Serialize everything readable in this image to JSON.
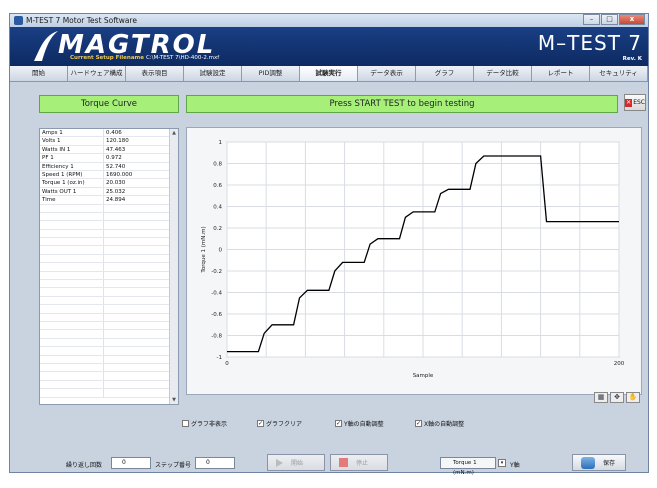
{
  "window": {
    "title": "M-TEST 7 Motor Test Software",
    "controls": [
      "–",
      "□",
      "x"
    ]
  },
  "banner": {
    "logo": "MAGTROL",
    "setup_label": "Current Setup Filename",
    "setup_file": "C:\\M-TEST 7\\HD-400-2.mxf",
    "product": "M–TEST 7",
    "rev": "Rev. K"
  },
  "tabs": [
    {
      "label": "開始"
    },
    {
      "label": "ハードウェア構成"
    },
    {
      "label": "表示項目"
    },
    {
      "label": "試験設定"
    },
    {
      "label": "PID調整"
    },
    {
      "label": "試験実行",
      "active": true
    },
    {
      "label": "データ表示"
    },
    {
      "label": "グラフ"
    },
    {
      "label": "データ比較"
    },
    {
      "label": "レポート"
    },
    {
      "label": "セキュリティ"
    }
  ],
  "curve_label": "Torque Curve",
  "status": "Press START TEST to begin testing",
  "esc_label": "ESC",
  "readings": [
    {
      "name": "Amps 1",
      "value": "0.406"
    },
    {
      "name": "Volts 1",
      "value": "120.180"
    },
    {
      "name": "Watts IN 1",
      "value": "47.463"
    },
    {
      "name": "PF 1",
      "value": "0.972"
    },
    {
      "name": "Efficiency 1",
      "value": "52.740"
    },
    {
      "name": "Speed 1 (RPM)",
      "value": "1690.000"
    },
    {
      "name": "Torque 1 (oz.in)",
      "value": "20.030"
    },
    {
      "name": "Watts OUT 1",
      "value": "25.032"
    },
    {
      "name": "Time",
      "value": "24.894"
    }
  ],
  "chart_data": {
    "type": "line",
    "xlabel": "Sample",
    "ylabel": "Torque 1 (mN.m)",
    "xlim": [
      0,
      200
    ],
    "ylim": [
      -1,
      1
    ],
    "xticks": [
      "0",
      "200"
    ],
    "yticks": [
      "-1",
      "-0.8",
      "-0.6",
      "-0.4",
      "-0.2",
      "0",
      "0.2",
      "0.4",
      "0.6",
      "0.8",
      "1"
    ],
    "grid": true,
    "series": [
      {
        "color": "#000000",
        "x": [
          0,
          16,
          19,
          23,
          34,
          37,
          41,
          52,
          55,
          59,
          70,
          73,
          77,
          88,
          91,
          95,
          106,
          109,
          113,
          124,
          127,
          131,
          143,
          146,
          150,
          160,
          163,
          200
        ],
        "y": [
          -0.95,
          -0.95,
          -0.78,
          -0.7,
          -0.7,
          -0.45,
          -0.38,
          -0.38,
          -0.2,
          -0.12,
          -0.12,
          0.05,
          0.1,
          0.1,
          0.3,
          0.35,
          0.35,
          0.52,
          0.56,
          0.56,
          0.8,
          0.87,
          0.87,
          0.87,
          0.87,
          0.87,
          0.26,
          0.26
        ]
      }
    ]
  },
  "checkboxes": [
    {
      "label": "グラフ非表示",
      "checked": false
    },
    {
      "label": "グラフクリア",
      "checked": true
    },
    {
      "label": "Y軸の自動調整",
      "checked": true
    },
    {
      "label": "X軸の自動調整",
      "checked": true
    }
  ],
  "bottom": {
    "repeat_label": "繰り返し回数",
    "repeat_value": "0",
    "step_label": "ステップ番号",
    "step_value": "0",
    "start_label": "開始",
    "stop_label": "停止",
    "axis_select": "Torque 1 (mN.m)",
    "axis_label": "Y軸",
    "save_label": "保存"
  },
  "colors": {
    "status_green": "#a6f07a",
    "banner_blue": "#12357a"
  }
}
